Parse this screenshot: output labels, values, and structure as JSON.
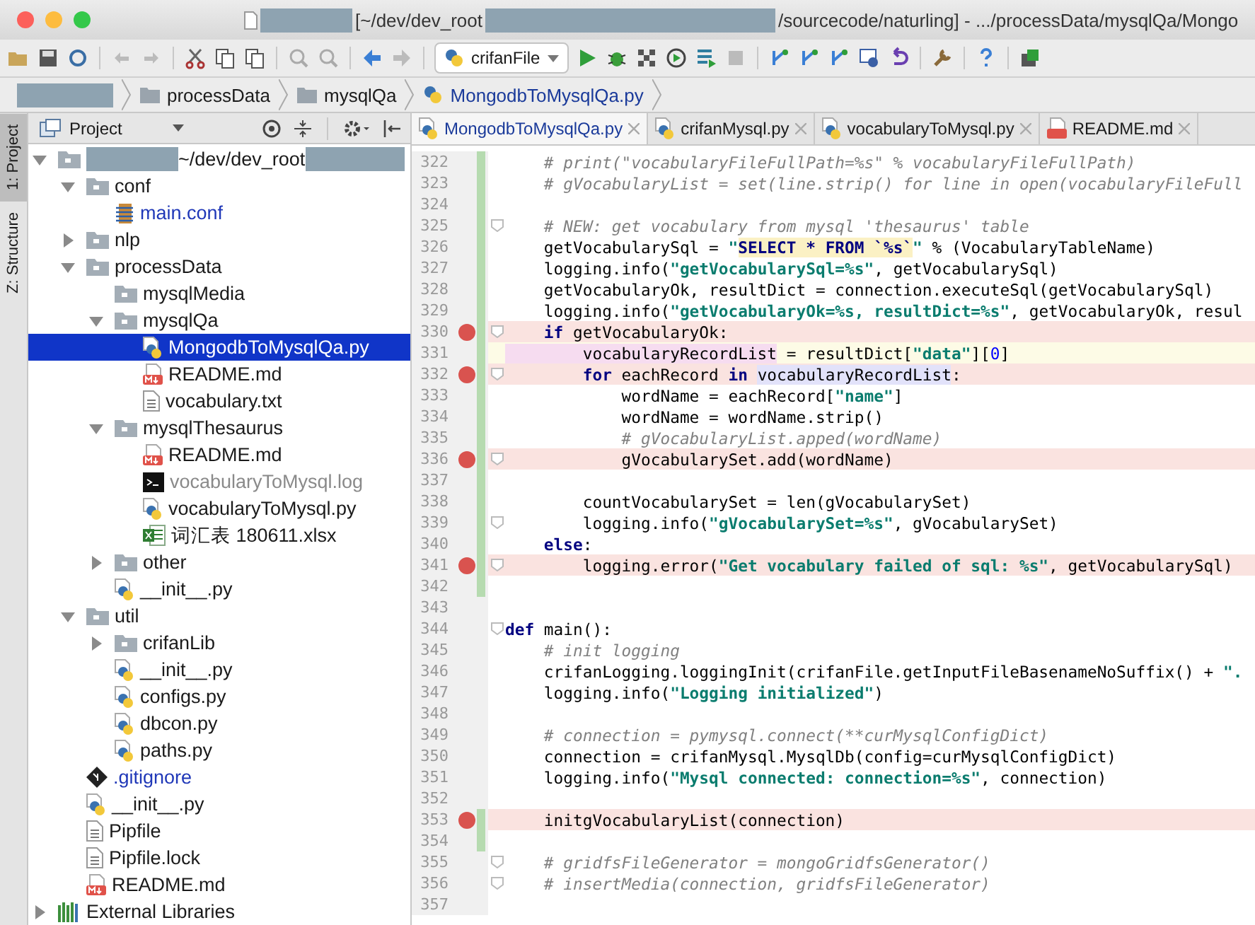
{
  "window": {
    "title": [
      {
        "kind": "redacted"
      },
      {
        "kind": "text",
        "text": "[~/dev/dev_root"
      },
      {
        "kind": "redacted"
      },
      {
        "kind": "text",
        "text": "/sourcecode/naturling] - .../processData/mysqlQa/Mongo"
      }
    ]
  },
  "toolbar": {
    "run_config": "crifanFile"
  },
  "breadcrumbs": [
    {
      "kind": "redacted"
    },
    {
      "kind": "folder",
      "label": "processData"
    },
    {
      "kind": "folder",
      "label": "mysqlQa"
    },
    {
      "kind": "python",
      "label": "MongodbToMysqlQa.py"
    }
  ],
  "side_tabs": [
    {
      "label": "1: Project",
      "selected": true
    },
    {
      "label": "Z: Structure",
      "selected": false
    }
  ],
  "project": {
    "title": "Project",
    "tree": [
      {
        "kind": "root",
        "label": "~/dev/dev_root",
        "color": "#1a1a1a",
        "expanded": true,
        "selected": false,
        "children": [
          {
            "label": "conf",
            "kind": "folder",
            "color": "#1a1a1a",
            "expanded": true,
            "selected": false,
            "children": [
              {
                "label": "main.conf",
                "kind": "config",
                "color": "#2038b8",
                "selected": false
              }
            ]
          },
          {
            "label": "nlp",
            "kind": "folder",
            "color": "#1a1a1a",
            "expanded": false,
            "selected": false
          },
          {
            "label": "processData",
            "kind": "folder",
            "color": "#1a1a1a",
            "expanded": true,
            "selected": false,
            "children": [
              {
                "label": "mysqlMedia",
                "kind": "folder",
                "color": "#1a1a1a",
                "selected": false
              },
              {
                "label": "mysqlQa",
                "kind": "folder",
                "color": "#1a1a1a",
                "expanded": true,
                "selected": false,
                "children": [
                  {
                    "label": "MongodbToMysqlQa.py",
                    "kind": "python",
                    "selected": true
                  },
                  {
                    "label": "README.md",
                    "kind": "markdown",
                    "color": "#1a1a1a",
                    "selected": false
                  },
                  {
                    "label": "vocabulary.txt",
                    "kind": "text",
                    "color": "#1a1a1a",
                    "selected": false
                  }
                ]
              },
              {
                "label": "mysqlThesaurus",
                "kind": "folder",
                "color": "#1a1a1a",
                "expanded": true,
                "selected": false,
                "children": [
                  {
                    "label": "README.md",
                    "kind": "markdown",
                    "color": "#1a1a1a",
                    "selected": false
                  },
                  {
                    "label": "vocabularyToMysql.log",
                    "kind": "log",
                    "color": "#8a8a8a",
                    "selected": false
                  },
                  {
                    "label": "vocabularyToMysql.py",
                    "kind": "python",
                    "color": "#1a1a1a",
                    "selected": false
                  },
                  {
                    "label": "词汇表 180611.xlsx",
                    "kind": "excel",
                    "color": "#1a1a1a",
                    "selected": false
                  }
                ]
              },
              {
                "label": "other",
                "kind": "folder",
                "color": "#1a1a1a",
                "expanded": false,
                "selected": false
              },
              {
                "label": "__init__.py",
                "kind": "python",
                "color": "#1a1a1a",
                "selected": false
              }
            ]
          },
          {
            "label": "util",
            "kind": "folder",
            "color": "#1a1a1a",
            "expanded": true,
            "selected": false,
            "children": [
              {
                "label": "crifanLib",
                "kind": "folder",
                "color": "#1a1a1a",
                "expanded": false,
                "selected": false
              },
              {
                "label": "__init__.py",
                "kind": "python",
                "color": "#1a1a1a",
                "selected": false
              },
              {
                "label": "configs.py",
                "kind": "python",
                "color": "#1a1a1a",
                "selected": false
              },
              {
                "label": "dbcon.py",
                "kind": "python",
                "color": "#1a1a1a",
                "selected": false
              },
              {
                "label": "paths.py",
                "kind": "python",
                "color": "#1a1a1a",
                "selected": false
              }
            ]
          },
          {
            "label": ".gitignore",
            "kind": "git",
            "color": "#2038b8",
            "selected": false
          },
          {
            "label": "__init__.py",
            "kind": "python",
            "color": "#1a1a1a",
            "selected": false
          },
          {
            "label": "Pipfile",
            "kind": "text",
            "color": "#1a1a1a",
            "selected": false
          },
          {
            "label": "Pipfile.lock",
            "kind": "text",
            "color": "#1a1a1a",
            "selected": false
          },
          {
            "label": "README.md",
            "kind": "markdown",
            "color": "#1a1a1a",
            "selected": false
          }
        ]
      },
      {
        "label": "External Libraries",
        "kind": "library",
        "color": "#1a1a1a",
        "expanded": false,
        "selected": false
      }
    ]
  },
  "editor": {
    "tabs": [
      {
        "label": "MongodbToMysqlQa.py",
        "kind": "python",
        "selected": true
      },
      {
        "label": "crifanMysql.py",
        "kind": "python",
        "selected": false
      },
      {
        "label": "vocabularyToMysql.py",
        "kind": "python",
        "selected": false
      },
      {
        "label": "README.md",
        "kind": "markdown",
        "selected": false
      }
    ],
    "lines": [
      {
        "num": "322",
        "breakpoint": false,
        "current": false,
        "changed": true,
        "fold": false,
        "segments": [
          {
            "kind": "comment",
            "text": "    # print(\"vocabularyFileFullPath=%s\" % vocabularyFileFullPath)"
          }
        ]
      },
      {
        "num": "323",
        "breakpoint": false,
        "current": false,
        "changed": true,
        "fold": false,
        "segments": [
          {
            "kind": "comment",
            "text": "    # gVocabularyList = set(line.strip() for line in open(vocabularyFileFull"
          }
        ]
      },
      {
        "num": "324",
        "breakpoint": false,
        "current": false,
        "changed": true,
        "fold": false
      },
      {
        "num": "325",
        "breakpoint": false,
        "current": false,
        "changed": true,
        "fold": true,
        "segments": [
          {
            "kind": "comment",
            "text": "    # NEW: get vocabulary from mysql 'thesaurus' table"
          }
        ]
      },
      {
        "num": "326",
        "breakpoint": false,
        "current": false,
        "changed": true,
        "fold": false,
        "segments": [
          {
            "kind": "plain",
            "text": "    getVocabularySql = "
          },
          {
            "kind": "string",
            "text": "\""
          },
          {
            "kind": "sql",
            "text": "SELECT * FROM `%s`"
          },
          {
            "kind": "string",
            "text": "\""
          },
          {
            "kind": "plain",
            "text": " % (VocabularyTableName)"
          }
        ]
      },
      {
        "num": "327",
        "breakpoint": false,
        "current": false,
        "changed": true,
        "fold": false,
        "segments": [
          {
            "kind": "plain",
            "text": "    logging.info("
          },
          {
            "kind": "string",
            "text": "\"getVocabularySql=%s\""
          },
          {
            "kind": "plain",
            "text": ", getVocabularySql)"
          }
        ]
      },
      {
        "num": "328",
        "breakpoint": false,
        "current": false,
        "changed": true,
        "fold": false,
        "segments": [
          {
            "kind": "plain",
            "text": "    getVocabularyOk, resultDict = connection.executeSql(getVocabularySql)"
          }
        ]
      },
      {
        "num": "329",
        "breakpoint": false,
        "current": false,
        "changed": true,
        "fold": false,
        "segments": [
          {
            "kind": "plain",
            "text": "    logging.info("
          },
          {
            "kind": "string",
            "text": "\"getVocabularyOk=%s, resultDict=%s\""
          },
          {
            "kind": "plain",
            "text": ", getVocabularyOk, resul"
          }
        ]
      },
      {
        "num": "330",
        "breakpoint": true,
        "current": false,
        "changed": true,
        "fold": true,
        "segments": [
          {
            "kind": "keyword",
            "text": "    if"
          },
          {
            "kind": "plain",
            "text": " getVocabularyOk:"
          }
        ]
      },
      {
        "num": "331",
        "breakpoint": false,
        "current": true,
        "changed": true,
        "fold": false,
        "segments": [
          {
            "kind": "var_write",
            "text": "        vocabularyRecordList"
          },
          {
            "kind": "plain",
            "text": " = resultDict["
          },
          {
            "kind": "string",
            "text": "\"data\""
          },
          {
            "kind": "plain",
            "text": "]["
          },
          {
            "kind": "number",
            "text": "0"
          },
          {
            "kind": "plain",
            "text": "]"
          }
        ]
      },
      {
        "num": "332",
        "breakpoint": true,
        "current": false,
        "changed": true,
        "fold": true,
        "segments": [
          {
            "kind": "keyword",
            "text": "        for"
          },
          {
            "kind": "plain",
            "text": " eachRecord "
          },
          {
            "kind": "keyword",
            "text": "in "
          },
          {
            "kind": "var_read",
            "text": "vocabularyRecordList"
          },
          {
            "kind": "plain",
            "text": ":"
          }
        ]
      },
      {
        "num": "333",
        "breakpoint": false,
        "current": false,
        "changed": true,
        "fold": false,
        "segments": [
          {
            "kind": "plain",
            "text": "            wordName = eachRecord["
          },
          {
            "kind": "string",
            "text": "\"name\""
          },
          {
            "kind": "plain",
            "text": "]"
          }
        ]
      },
      {
        "num": "334",
        "breakpoint": false,
        "current": false,
        "changed": true,
        "fold": false,
        "segments": [
          {
            "kind": "plain",
            "text": "            wordName = wordName.strip()"
          }
        ]
      },
      {
        "num": "335",
        "breakpoint": false,
        "current": false,
        "changed": true,
        "fold": false,
        "segments": [
          {
            "kind": "comment",
            "text": "            # gVocabularyList.apped(wordName)"
          }
        ]
      },
      {
        "num": "336",
        "breakpoint": true,
        "current": false,
        "changed": true,
        "fold": true,
        "segments": [
          {
            "kind": "plain",
            "text": "            gVocabularySet.add(wordName)"
          }
        ]
      },
      {
        "num": "337",
        "breakpoint": false,
        "current": false,
        "changed": true,
        "fold": false
      },
      {
        "num": "338",
        "breakpoint": false,
        "current": false,
        "changed": true,
        "fold": false,
        "segments": [
          {
            "kind": "plain",
            "text": "        countVocabularySet = len(gVocabularySet)"
          }
        ]
      },
      {
        "num": "339",
        "breakpoint": false,
        "current": false,
        "changed": true,
        "fold": true,
        "segments": [
          {
            "kind": "plain",
            "text": "        logging.info("
          },
          {
            "kind": "string",
            "text": "\"gVocabularySet=%s\""
          },
          {
            "kind": "plain",
            "text": ", gVocabularySet)"
          }
        ]
      },
      {
        "num": "340",
        "breakpoint": false,
        "current": false,
        "changed": true,
        "fold": false,
        "segments": [
          {
            "kind": "keyword",
            "text": "    else"
          },
          {
            "kind": "plain",
            "text": ":"
          }
        ]
      },
      {
        "num": "341",
        "breakpoint": true,
        "current": false,
        "changed": true,
        "fold": true,
        "segments": [
          {
            "kind": "plain",
            "text": "        logging.error("
          },
          {
            "kind": "string",
            "text": "\"Get vocabulary failed of sql: %s\""
          },
          {
            "kind": "plain",
            "text": ", getVocabularySql)"
          }
        ]
      },
      {
        "num": "342",
        "breakpoint": false,
        "current": false,
        "changed": true,
        "fold": false
      },
      {
        "num": "343",
        "breakpoint": false,
        "current": false,
        "changed": false,
        "fold": false
      },
      {
        "num": "344",
        "breakpoint": false,
        "current": false,
        "changed": false,
        "fold": true,
        "segments": [
          {
            "kind": "keyword",
            "text": "def"
          },
          {
            "kind": "plain",
            "text": " main():"
          }
        ]
      },
      {
        "num": "345",
        "breakpoint": false,
        "current": false,
        "changed": false,
        "fold": false,
        "segments": [
          {
            "kind": "comment",
            "text": "    # init logging"
          }
        ]
      },
      {
        "num": "346",
        "breakpoint": false,
        "current": false,
        "changed": false,
        "fold": false,
        "segments": [
          {
            "kind": "plain",
            "text": "    crifanLogging.loggingInit(crifanFile.getInputFileBasenameNoSuffix() + "
          },
          {
            "kind": "string",
            "text": "\"."
          }
        ]
      },
      {
        "num": "347",
        "breakpoint": false,
        "current": false,
        "changed": false,
        "fold": false,
        "segments": [
          {
            "kind": "plain",
            "text": "    logging.info("
          },
          {
            "kind": "string",
            "text": "\"Logging initialized\""
          },
          {
            "kind": "plain",
            "text": ")"
          }
        ]
      },
      {
        "num": "348",
        "breakpoint": false,
        "current": false,
        "changed": false,
        "fold": false
      },
      {
        "num": "349",
        "breakpoint": false,
        "current": false,
        "changed": false,
        "fold": false,
        "segments": [
          {
            "kind": "comment",
            "text": "    # connection = pymysql.connect(**curMysqlConfigDict)"
          }
        ]
      },
      {
        "num": "350",
        "breakpoint": false,
        "current": false,
        "changed": false,
        "fold": false,
        "segments": [
          {
            "kind": "plain",
            "text": "    connection = crifanMysql.MysqlDb(config=curMysqlConfigDict)"
          }
        ]
      },
      {
        "num": "351",
        "breakpoint": false,
        "current": false,
        "changed": false,
        "fold": false,
        "segments": [
          {
            "kind": "plain",
            "text": "    logging.info("
          },
          {
            "kind": "string",
            "text": "\"Mysql connected: connection=%s\""
          },
          {
            "kind": "plain",
            "text": ", connection)"
          }
        ]
      },
      {
        "num": "352",
        "breakpoint": false,
        "current": false,
        "changed": false,
        "fold": false
      },
      {
        "num": "353",
        "breakpoint": true,
        "current": false,
        "changed": true,
        "fold": false,
        "segments": [
          {
            "kind": "plain",
            "text": "    initgVocabularyList(connection)"
          }
        ]
      },
      {
        "num": "354",
        "breakpoint": false,
        "current": false,
        "changed": true,
        "fold": false
      },
      {
        "num": "355",
        "breakpoint": false,
        "current": false,
        "changed": false,
        "fold": true,
        "segments": [
          {
            "kind": "comment",
            "text": "    # gridfsFileGenerator = mongoGridfsGenerator()"
          }
        ]
      },
      {
        "num": "356",
        "breakpoint": false,
        "current": false,
        "changed": false,
        "fold": true,
        "segments": [
          {
            "kind": "comment",
            "text": "    # insertMedia(connection, gridfsFileGenerator)"
          }
        ]
      },
      {
        "num": "357",
        "breakpoint": false,
        "current": false,
        "changed": false,
        "fold": false
      }
    ]
  }
}
